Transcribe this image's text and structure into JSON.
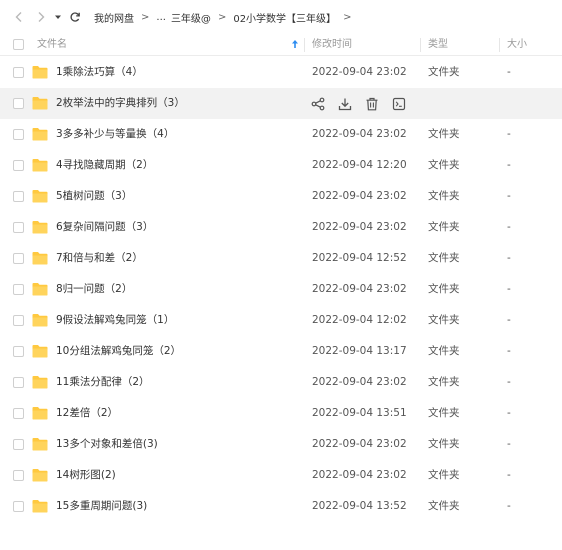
{
  "breadcrumb": {
    "items": [
      "我的网盘",
      "...",
      "三年级@",
      "02小学数学【三年级】"
    ],
    "separator": ">"
  },
  "columns": {
    "name": "文件名",
    "modified": "修改时间",
    "type": "类型",
    "size": "大小"
  },
  "colors": {
    "folder": "#FFC940",
    "sort_arrow": "#2c8cf0",
    "hover_row": "#f2f2f2"
  },
  "rows": [
    {
      "name": "1乘除法巧算（4）",
      "date": "2022-09-04 23:02",
      "type": "文件夹",
      "size": "-"
    },
    {
      "name": "2枚举法中的字典排列（3）",
      "date": "",
      "type": "",
      "size": "",
      "hover": true
    },
    {
      "name": "3多多补少与等量换（4）",
      "date": "2022-09-04 23:02",
      "type": "文件夹",
      "size": "-"
    },
    {
      "name": "4寻找隐藏周期（2）",
      "date": "2022-09-04 12:20",
      "type": "文件夹",
      "size": "-"
    },
    {
      "name": "5植树问题（3）",
      "date": "2022-09-04 23:02",
      "type": "文件夹",
      "size": "-"
    },
    {
      "name": "6复杂间隔问题（3）",
      "date": "2022-09-04 23:02",
      "type": "文件夹",
      "size": "-"
    },
    {
      "name": "7和倍与和差（2）",
      "date": "2022-09-04 12:52",
      "type": "文件夹",
      "size": "-"
    },
    {
      "name": "8归一问题（2）",
      "date": "2022-09-04 23:02",
      "type": "文件夹",
      "size": "-"
    },
    {
      "name": "9假设法解鸡兔同笼（1）",
      "date": "2022-09-04 12:02",
      "type": "文件夹",
      "size": "-"
    },
    {
      "name": "10分组法解鸡兔同笼（2）",
      "date": "2022-09-04 13:17",
      "type": "文件夹",
      "size": "-"
    },
    {
      "name": "11乘法分配律（2）",
      "date": "2022-09-04 23:02",
      "type": "文件夹",
      "size": "-"
    },
    {
      "name": "12差倍（2）",
      "date": "2022-09-04 13:51",
      "type": "文件夹",
      "size": "-"
    },
    {
      "name": "13多个对象和差倍(3)",
      "date": "2022-09-04 23:02",
      "type": "文件夹",
      "size": "-"
    },
    {
      "name": "14树形图(2)",
      "date": "2022-09-04 23:02",
      "type": "文件夹",
      "size": "-"
    },
    {
      "name": "15多重周期问题(3)",
      "date": "2022-09-04 13:52",
      "type": "文件夹",
      "size": "-"
    }
  ],
  "row_actions": [
    "share-icon",
    "download-icon",
    "delete-icon",
    "more-icon"
  ]
}
